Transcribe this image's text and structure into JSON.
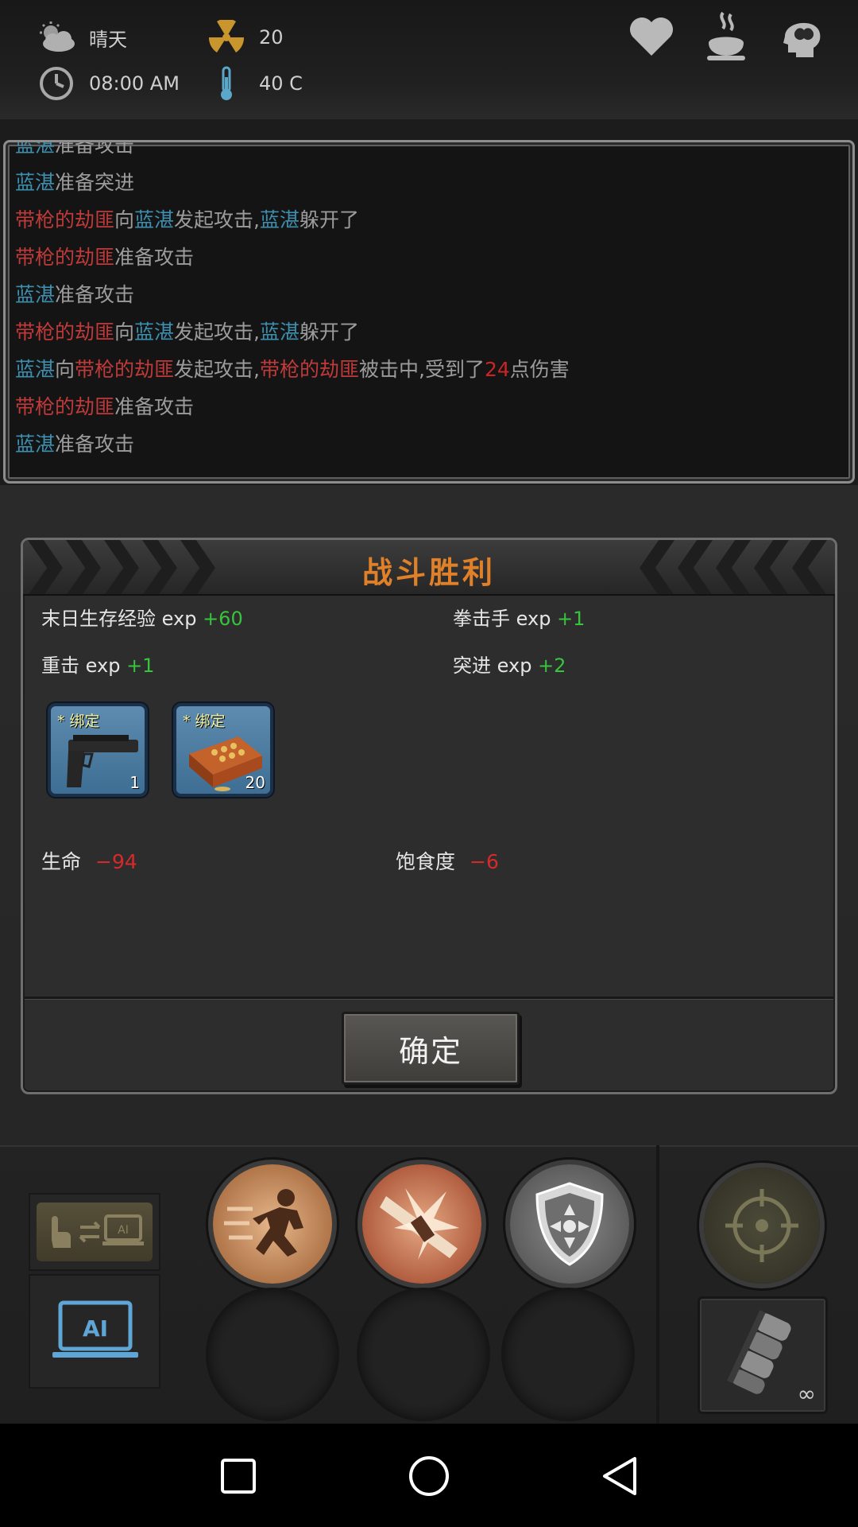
{
  "status": {
    "weather": "晴天",
    "radiation": "20",
    "time": "08:00 AM",
    "temperature": "40 C"
  },
  "top_icons": [
    "heart-icon",
    "stomach-icon",
    "mind-icon"
  ],
  "combat_log": [
    [
      {
        "t": "蓝湛",
        "c": "p"
      },
      {
        "t": "准备攻击",
        "c": ""
      }
    ],
    [
      {
        "t": "蓝湛",
        "c": "p"
      },
      {
        "t": "准备突进",
        "c": ""
      }
    ],
    [
      {
        "t": "带枪的劫匪",
        "c": "e"
      },
      {
        "t": "向",
        "c": ""
      },
      {
        "t": "蓝湛",
        "c": "p"
      },
      {
        "t": "发起攻击,",
        "c": ""
      },
      {
        "t": "蓝湛",
        "c": "p"
      },
      {
        "t": "躲开了",
        "c": ""
      }
    ],
    [
      {
        "t": "带枪的劫匪",
        "c": "e"
      },
      {
        "t": "准备攻击",
        "c": ""
      }
    ],
    [
      {
        "t": "蓝湛",
        "c": "p"
      },
      {
        "t": "准备攻击",
        "c": ""
      }
    ],
    [
      {
        "t": "带枪的劫匪",
        "c": "e"
      },
      {
        "t": "向",
        "c": ""
      },
      {
        "t": "蓝湛",
        "c": "p"
      },
      {
        "t": "发起攻击,",
        "c": ""
      },
      {
        "t": "蓝湛",
        "c": "p"
      },
      {
        "t": "躲开了",
        "c": ""
      }
    ],
    [
      {
        "t": "蓝湛",
        "c": "p"
      },
      {
        "t": "向",
        "c": ""
      },
      {
        "t": "带枪的劫匪",
        "c": "e"
      },
      {
        "t": "发起攻击,",
        "c": ""
      },
      {
        "t": "带枪的劫匪",
        "c": "e"
      },
      {
        "t": "被击中,受到了",
        "c": ""
      },
      {
        "t": "24",
        "c": "d"
      },
      {
        "t": "点伤害",
        "c": ""
      }
    ],
    [
      {
        "t": "带枪的劫匪",
        "c": "e"
      },
      {
        "t": "准备攻击",
        "c": ""
      }
    ],
    [
      {
        "t": "蓝湛",
        "c": "p"
      },
      {
        "t": "准备攻击",
        "c": ""
      }
    ]
  ],
  "dialog": {
    "title": "战斗胜利",
    "exp": [
      {
        "name": "末日生存经验",
        "unit": "exp",
        "value": "+60"
      },
      {
        "name": "拳击手",
        "unit": "exp",
        "value": "+1"
      },
      {
        "name": "重击",
        "unit": "exp",
        "value": "+1"
      },
      {
        "name": "突进",
        "unit": "exp",
        "value": "+2"
      }
    ],
    "items": [
      {
        "tag": "* 绑定",
        "count": "1",
        "icon": "pistol-icon"
      },
      {
        "tag": "* 绑定",
        "count": "20",
        "icon": "ammo-box-icon"
      }
    ],
    "health": {
      "label": "生命",
      "value": "−94"
    },
    "satiety": {
      "label": "饱食度",
      "value": "−6"
    },
    "confirm_label": "确定"
  },
  "controls": {
    "mode_switch_ai_label": "AI",
    "ai_label": "AI",
    "skills": [
      "dash-skill-icon",
      "heavy-strike-skill-icon",
      "defend-skill-icon"
    ],
    "target_icon": "crosshair-icon",
    "weapon_count": "∞"
  },
  "colors": {
    "player_name": "#3d8fb0",
    "enemy_name": "#c03a3a",
    "damage": "#c82626",
    "exp_gain": "#38c43c",
    "stat_loss": "#d62a2a",
    "title": "#e0812a"
  }
}
